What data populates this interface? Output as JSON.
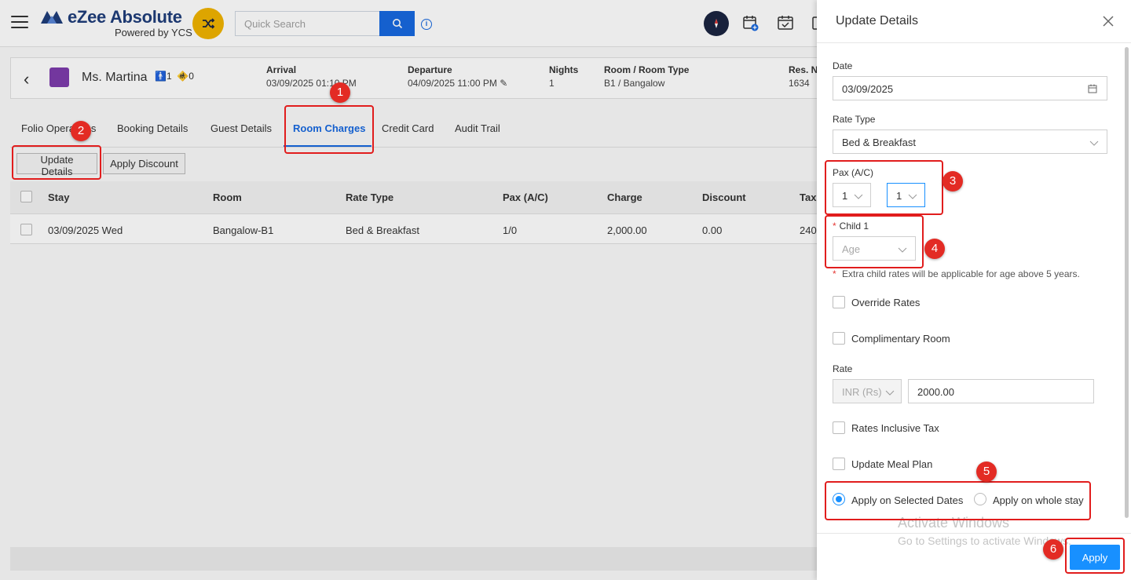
{
  "header": {
    "brand": "eZee Absolute",
    "brand_sub": "Powered by YCS",
    "search_placeholder": "Quick Search"
  },
  "guest": {
    "name": "Ms. Martina",
    "adults": "1",
    "children": "0",
    "arrival_label": "Arrival",
    "arrival_value": "03/09/2025 01:10 PM",
    "departure_label": "Departure",
    "departure_value": "04/09/2025 11:00 PM",
    "nights_label": "Nights",
    "nights_value": "1",
    "room_label": "Room / Room Type",
    "room_value": "B1 / Bangalow",
    "res_label": "Res. No",
    "res_value": "1634"
  },
  "tabs": [
    {
      "label": "Folio Operations"
    },
    {
      "label": "Booking Details"
    },
    {
      "label": "Guest Details"
    },
    {
      "label": "Room Charges"
    },
    {
      "label": "Credit Card"
    },
    {
      "label": "Audit Trail"
    }
  ],
  "actions": {
    "update_details": "Update Details",
    "apply_discount": "Apply Discount"
  },
  "table": {
    "columns": [
      "Stay",
      "Room",
      "Rate Type",
      "Pax (A/C)",
      "Charge",
      "Discount",
      "Tax"
    ],
    "rows": [
      {
        "stay": "03/09/2025 Wed",
        "room": "Bangalow-B1",
        "rate_type": "Bed & Breakfast",
        "pax": "1/0",
        "charge": "2,000.00",
        "discount": "0.00",
        "tax": "240"
      }
    ]
  },
  "panel": {
    "title": "Update Details",
    "date_label": "Date",
    "date_value": "03/09/2025",
    "rate_type_label": "Rate Type",
    "rate_type_value": "Bed & Breakfast",
    "pax_label": "Pax (A/C)",
    "pax_adult": "1",
    "pax_child": "1",
    "child1_label": "Child 1",
    "age_placeholder": "Age",
    "child_note": "Extra child rates will be applicable for age above 5 years.",
    "override_rates": "Override Rates",
    "complimentary_room": "Complimentary Room",
    "rate_label": "Rate",
    "currency": "INR (Rs)",
    "rate_value": "2000.00",
    "rates_inclusive_tax": "Rates Inclusive Tax",
    "update_meal_plan": "Update Meal Plan",
    "apply_selected": "Apply on Selected Dates",
    "apply_whole": "Apply on whole stay",
    "apply_button": "Apply"
  },
  "watermark": {
    "line1": "Activate Windows",
    "line2": "Go to Settings to activate Windows."
  },
  "annotations": [
    "1",
    "2",
    "3",
    "4",
    "5",
    "6"
  ],
  "colors": {
    "primary": "#1769e0",
    "apply": "#1890ff",
    "annotation": "#e11d1d",
    "logo_accent": "#f0b400"
  }
}
